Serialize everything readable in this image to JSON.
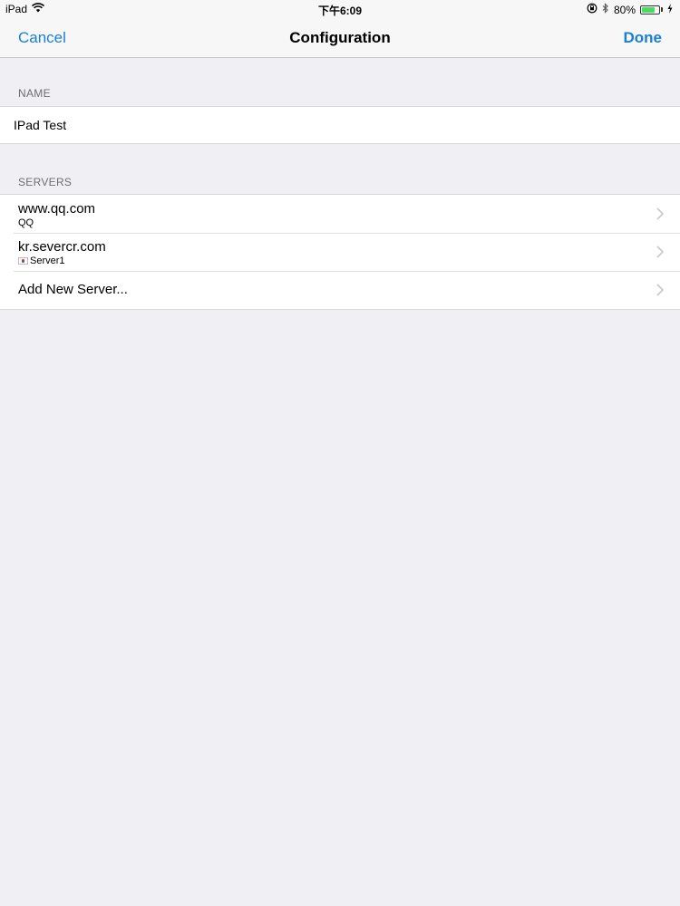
{
  "status_bar": {
    "device": "iPad",
    "time": "下午6:09",
    "battery": "80%",
    "battery_level": 0.8,
    "icons": [
      "wifi-icon",
      "orientation-lock-icon",
      "bluetooth-icon",
      "battery-icon",
      "charging-icon"
    ]
  },
  "nav": {
    "cancel_label": "Cancel",
    "title": "Configuration",
    "done_label": "Done"
  },
  "name_section": {
    "header": "NAME",
    "value": "IPad Test"
  },
  "servers_section": {
    "header": "SERVERS",
    "items": [
      {
        "host": "www.qq.com",
        "label": "QQ"
      },
      {
        "host": "kr.severcr.com",
        "label": "Server1",
        "flag": "south-korea-flag-icon"
      }
    ],
    "add_label": "Add New Server..."
  },
  "colors": {
    "accent": "#1a7fd6",
    "background": "#efeff4",
    "battery": "#4cd964"
  }
}
